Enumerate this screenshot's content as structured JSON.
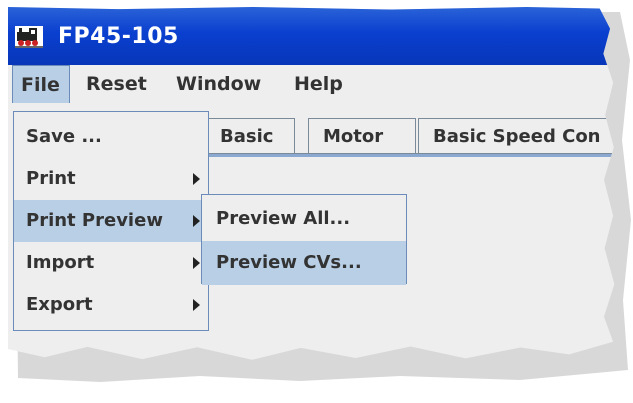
{
  "window": {
    "title": "FP45-105",
    "icon": "locomotive-icon"
  },
  "menubar": {
    "items": [
      "File",
      "Reset",
      "Window",
      "Help"
    ]
  },
  "tabs": [
    "Basic",
    "Motor",
    "Basic Speed Con"
  ],
  "file_menu": {
    "items": [
      {
        "label": "Save ...",
        "submenu": false
      },
      {
        "label": "Print",
        "submenu": true
      },
      {
        "label": "Print Preview",
        "submenu": true
      },
      {
        "label": "Import",
        "submenu": true
      },
      {
        "label": "Export",
        "submenu": true
      }
    ]
  },
  "print_preview_menu": {
    "items": [
      "Preview All...",
      "Preview CVs..."
    ]
  },
  "colors": {
    "title_bar": "#0a3fcf",
    "menu_highlight": "#b8cfe5",
    "background": "#eeeeee"
  }
}
